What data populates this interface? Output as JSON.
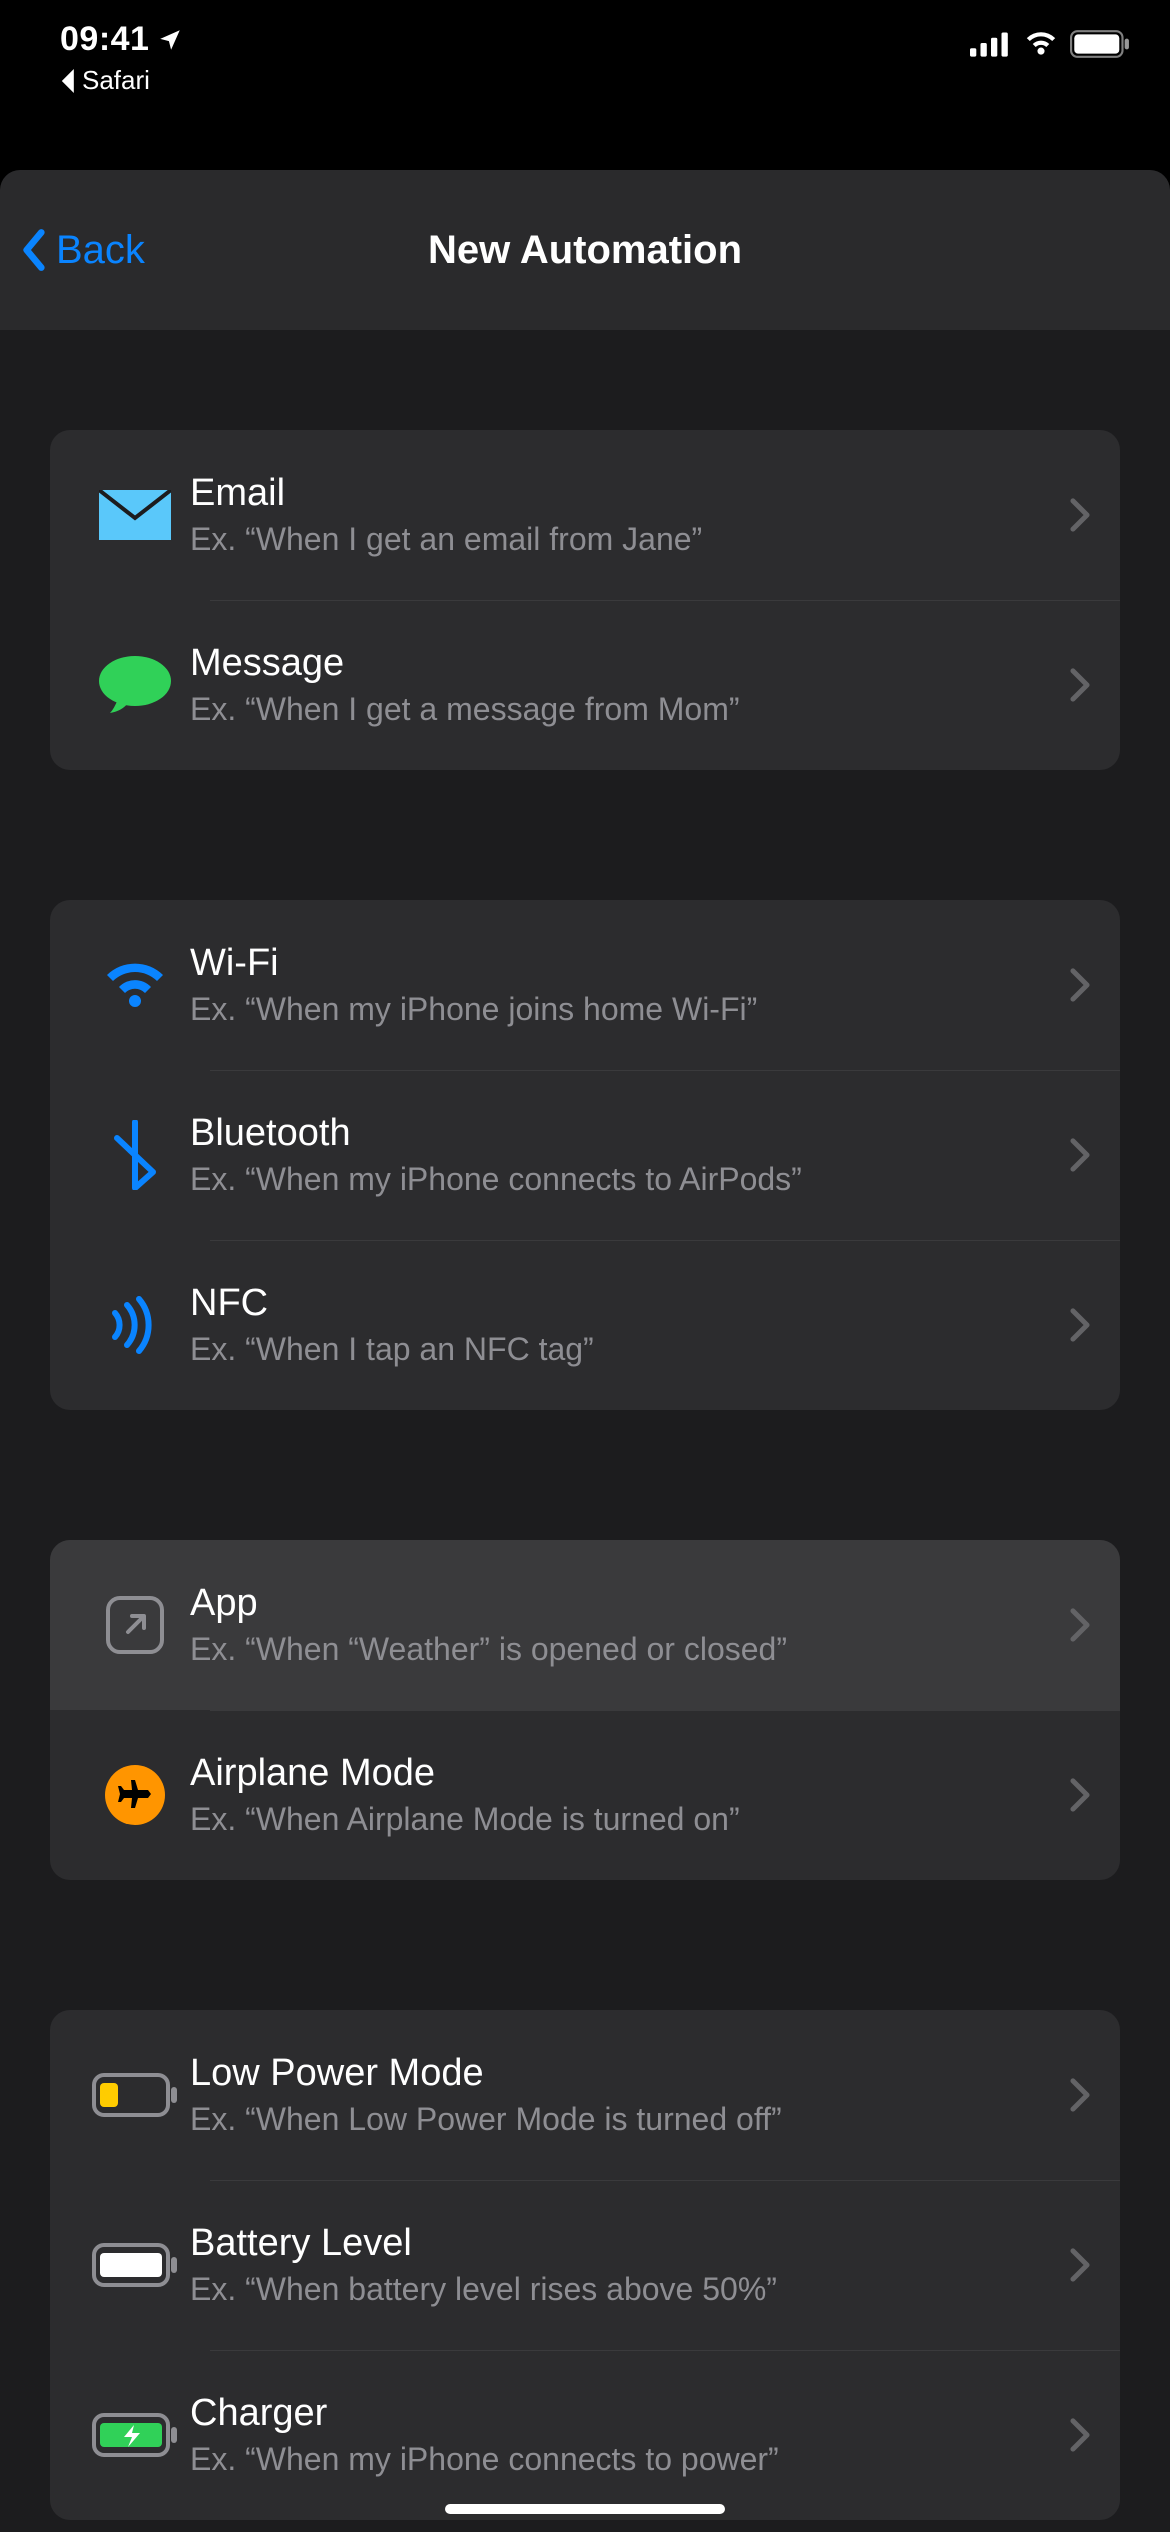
{
  "status": {
    "time": "09:41",
    "back_app": "Safari"
  },
  "nav": {
    "back": "Back",
    "title": "New Automation"
  },
  "groups": [
    {
      "rows": [
        {
          "icon": "email",
          "title": "Email",
          "subtitle": "Ex. “When I get an email from Jane”"
        },
        {
          "icon": "message",
          "title": "Message",
          "subtitle": "Ex. “When I get a message from Mom”"
        }
      ]
    },
    {
      "rows": [
        {
          "icon": "wifi",
          "title": "Wi-Fi",
          "subtitle": "Ex. “When my iPhone joins home Wi-Fi”"
        },
        {
          "icon": "bluetooth",
          "title": "Bluetooth",
          "subtitle": "Ex. “When my iPhone connects to AirPods”"
        },
        {
          "icon": "nfc",
          "title": "NFC",
          "subtitle": "Ex. “When I tap an NFC tag”"
        }
      ]
    },
    {
      "rows": [
        {
          "icon": "app",
          "title": "App",
          "subtitle": "Ex. “When “Weather” is opened or closed”",
          "highlighted": true
        },
        {
          "icon": "airplane",
          "title": "Airplane Mode",
          "subtitle": "Ex. “When Airplane Mode is turned on”"
        }
      ]
    },
    {
      "rows": [
        {
          "icon": "lowpower",
          "title": "Low Power Mode",
          "subtitle": "Ex. “When Low Power Mode is turned off”"
        },
        {
          "icon": "battery",
          "title": "Battery Level",
          "subtitle": "Ex. “When battery level rises above 50%”"
        },
        {
          "icon": "charger",
          "title": "Charger",
          "subtitle": "Ex. “When my iPhone connects to power”"
        }
      ]
    }
  ]
}
